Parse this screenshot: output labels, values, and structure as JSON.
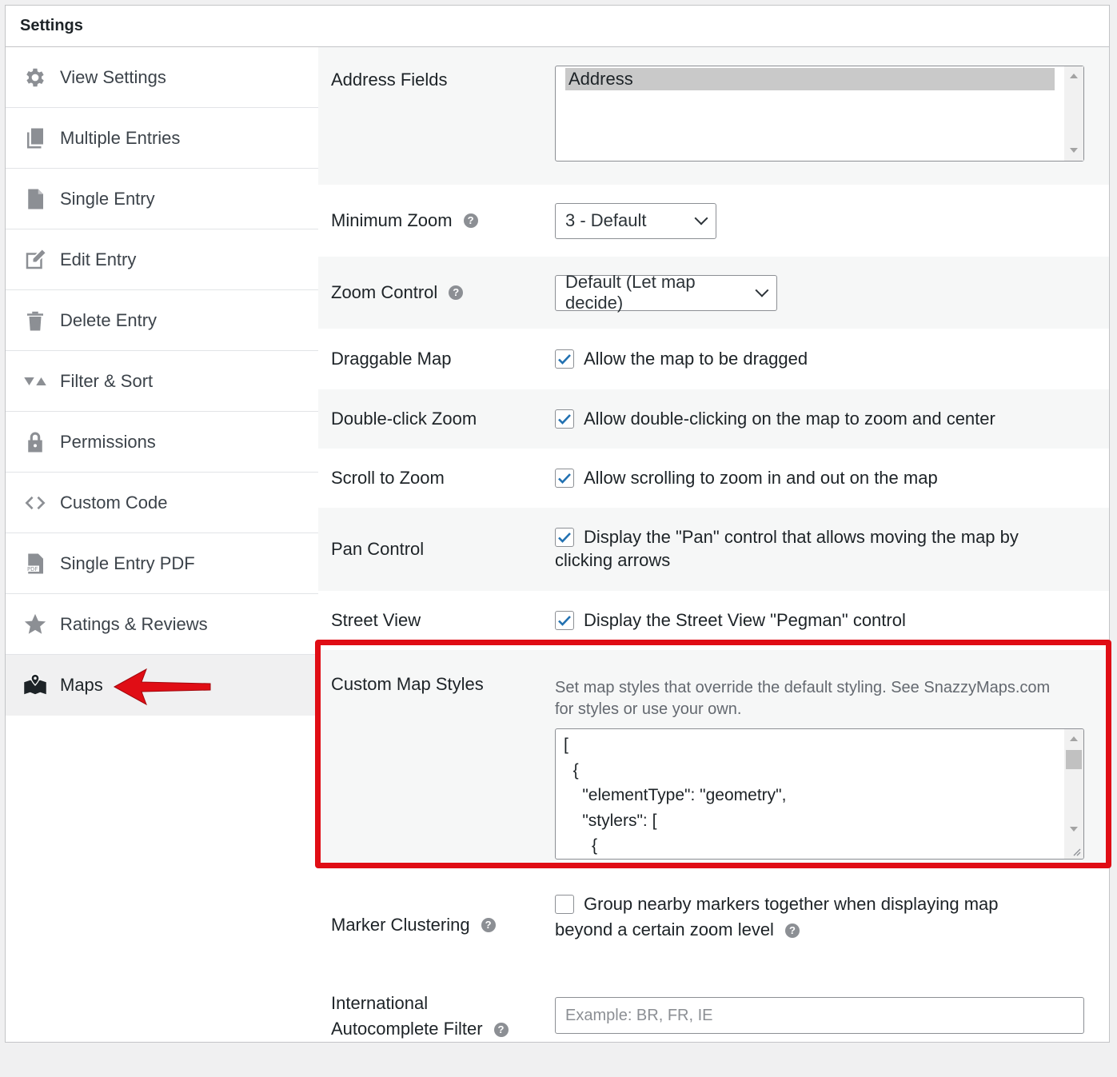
{
  "panel": {
    "title": "Settings"
  },
  "sidebar": {
    "items": [
      {
        "label": "View Settings",
        "icon": "gear-icon"
      },
      {
        "label": "Multiple Entries",
        "icon": "copy-icon"
      },
      {
        "label": "Single Entry",
        "icon": "document-icon"
      },
      {
        "label": "Edit Entry",
        "icon": "edit-icon"
      },
      {
        "label": "Delete Entry",
        "icon": "trash-icon"
      },
      {
        "label": "Filter & Sort",
        "icon": "filter-sort-icon"
      },
      {
        "label": "Permissions",
        "icon": "lock-icon"
      },
      {
        "label": "Custom Code",
        "icon": "code-icon"
      },
      {
        "label": "Single Entry PDF",
        "icon": "pdf-icon"
      },
      {
        "label": "Ratings & Reviews",
        "icon": "star-icon"
      },
      {
        "label": "Maps",
        "icon": "map-icon",
        "active": true
      }
    ]
  },
  "settings": {
    "address_fields": {
      "label": "Address Fields",
      "options": [
        "Address"
      ]
    },
    "minimum_zoom": {
      "label": "Minimum Zoom",
      "value": "3 - Default"
    },
    "zoom_control": {
      "label": "Zoom Control",
      "value": "Default (Let map decide)"
    },
    "draggable_map": {
      "label": "Draggable Map",
      "checked": true,
      "text": "Allow the map to be dragged"
    },
    "double_click_zoom": {
      "label": "Double-click Zoom",
      "checked": true,
      "text": "Allow double-clicking on the map to zoom and center"
    },
    "scroll_to_zoom": {
      "label": "Scroll to Zoom",
      "checked": true,
      "text": "Allow scrolling to zoom in and out on the map"
    },
    "pan_control": {
      "label": "Pan Control",
      "checked": true,
      "text_line1": "Display the \"Pan\" control that allows moving the map by",
      "text_line2": "clicking arrows"
    },
    "street_view": {
      "label": "Street View",
      "checked": true,
      "text": "Display the Street View \"Pegman\" control"
    },
    "custom_map_styles": {
      "label": "Custom Map Styles",
      "description_line1": "Set map styles that override the default styling. See SnazzyMaps.com",
      "description_line2": "for styles or use your own.",
      "code": "[\n  {\n    \"elementType\": \"geometry\",\n    \"stylers\": [\n      {"
    },
    "marker_clustering": {
      "label": "Marker Clustering",
      "checked": false,
      "text_line1": "Group nearby markers together when displaying map",
      "text_line2": "beyond a certain zoom level"
    },
    "autocomplete_filter": {
      "label_line1": "International",
      "label_line2": "Autocomplete Filter",
      "placeholder": "Example: BR, FR, IE",
      "value": ""
    }
  },
  "colors": {
    "highlight": "#e00d15",
    "arrow": "#e00d15",
    "checkmark": "#2271b1"
  }
}
